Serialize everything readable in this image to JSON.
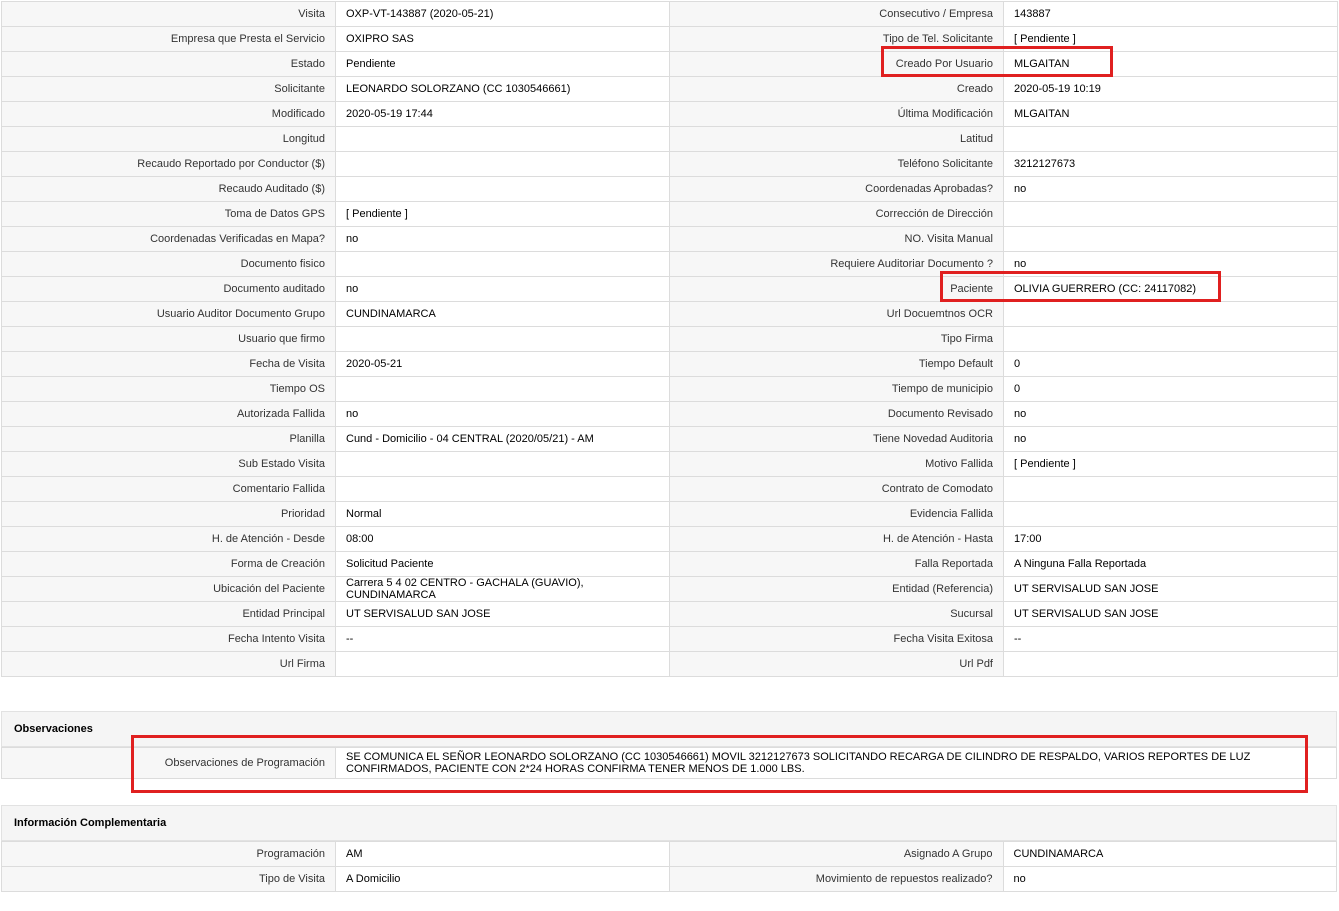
{
  "details": {
    "rows": [
      [
        {
          "label": "Visita",
          "value": "OXP-VT-143887 (2020-05-21)"
        },
        {
          "label": "Consecutivo / Empresa",
          "value": "143887"
        }
      ],
      [
        {
          "label": "Empresa que Presta el Servicio",
          "value": "OXIPRO SAS"
        },
        {
          "label": "Tipo de Tel. Solicitante",
          "value": "[ Pendiente ]"
        }
      ],
      [
        {
          "label": "Estado",
          "value": "Pendiente"
        },
        {
          "label": "Creado Por Usuario",
          "value": "MLGAITAN"
        }
      ],
      [
        {
          "label": "Solicitante",
          "value": "LEONARDO SOLORZANO (CC 1030546661)"
        },
        {
          "label": "Creado",
          "value": "2020-05-19 10:19"
        }
      ],
      [
        {
          "label": "Modificado",
          "value": "2020-05-19 17:44"
        },
        {
          "label": "Última Modificación",
          "value": " MLGAITAN"
        }
      ],
      [
        {
          "label": "Longitud",
          "value": ""
        },
        {
          "label": "Latitud",
          "value": ""
        }
      ],
      [
        {
          "label": "Recaudo Reportado por Conductor ($)",
          "value": ""
        },
        {
          "label": "Teléfono Solicitante",
          "value": "3212127673"
        }
      ],
      [
        {
          "label": "Recaudo Auditado ($)",
          "value": ""
        },
        {
          "label": "Coordenadas Aprobadas?",
          "value": " no"
        }
      ],
      [
        {
          "label": "Toma de Datos GPS",
          "value": "[ Pendiente ]"
        },
        {
          "label": "Corrección de Dirección",
          "value": ""
        }
      ],
      [
        {
          "label": "Coordenadas Verificadas en Mapa?",
          "value": " no"
        },
        {
          "label": "NO. Visita Manual",
          "value": ""
        }
      ],
      [
        {
          "label": "Documento fisico",
          "value": ""
        },
        {
          "label": "Requiere Auditoriar Documento ?",
          "value": " no"
        }
      ],
      [
        {
          "label": "Documento auditado",
          "value": " no"
        },
        {
          "label": "Paciente",
          "value": "OLIVIA GUERRERO (CC: 24117082)"
        }
      ],
      [
        {
          "label": "Usuario Auditor Documento Grupo",
          "value": "CUNDINAMARCA"
        },
        {
          "label": "Url Docuemtnos OCR",
          "value": ""
        }
      ],
      [
        {
          "label": "Usuario que firmo",
          "value": ""
        },
        {
          "label": "Tipo Firma",
          "value": ""
        }
      ],
      [
        {
          "label": "Fecha de Visita",
          "value": " 2020-05-21"
        },
        {
          "label": "Tiempo Default",
          "value": "0"
        }
      ],
      [
        {
          "label": "Tiempo OS",
          "value": ""
        },
        {
          "label": "Tiempo de municipio",
          "value": "0"
        }
      ],
      [
        {
          "label": "Autorizada Fallida",
          "value": " no"
        },
        {
          "label": "Documento Revisado",
          "value": " no"
        }
      ],
      [
        {
          "label": "Planilla",
          "value": "Cund - Domicilio - 04 CENTRAL (2020/05/21) - AM"
        },
        {
          "label": "Tiene Novedad Auditoria",
          "value": " no"
        }
      ],
      [
        {
          "label": "Sub Estado Visita",
          "value": ""
        },
        {
          "label": "Motivo Fallida",
          "value": "[ Pendiente ]"
        }
      ],
      [
        {
          "label": "Comentario Fallida",
          "value": ""
        },
        {
          "label": "Contrato de Comodato",
          "value": ""
        }
      ],
      [
        {
          "label": "Prioridad",
          "value": "Normal"
        },
        {
          "label": "Evidencia Fallida",
          "value": ""
        }
      ],
      [
        {
          "label": "H. de Atención - Desde",
          "value": "08:00"
        },
        {
          "label": "H. de Atención - Hasta",
          "value": "17:00"
        }
      ],
      [
        {
          "label": "Forma de Creación",
          "value": "Solicitud Paciente"
        },
        {
          "label": "Falla Reportada",
          "value": "A Ninguna Falla Reportada"
        }
      ],
      [
        {
          "label": "Ubicación del Paciente",
          "value": "Carrera 5 4 02 CENTRO - GACHALA (GUAVIO), CUNDINAMARCA"
        },
        {
          "label": "Entidad (Referencia)",
          "value": "UT SERVISALUD SAN JOSE"
        }
      ],
      [
        {
          "label": "Entidad Principal",
          "value": "UT SERVISALUD SAN JOSE"
        },
        {
          "label": "Sucursal",
          "value": "UT SERVISALUD SAN JOSE"
        }
      ],
      [
        {
          "label": "Fecha Intento Visita",
          "value": " --"
        },
        {
          "label": "Fecha Visita Exitosa",
          "value": " --"
        }
      ],
      [
        {
          "label": "Url Firma",
          "value": ""
        },
        {
          "label": "Url Pdf",
          "value": ""
        }
      ]
    ]
  },
  "observaciones": {
    "title": "Observaciones",
    "label": "Observaciones de Programación",
    "value": "  SE COMUNICA EL SEÑOR LEONARDO SOLORZANO (CC 1030546661) MOVIL 3212127673 SOLICITANDO RECARGA DE CILINDRO DE RESPALDO, VARIOS REPORTES DE LUZ CONFIRMADOS, PACIENTE CON 2*24 HORAS CONFIRMA TENER MENOS DE 1.000 LBS."
  },
  "complementaria": {
    "title": "Información Complementaria",
    "rows": [
      [
        {
          "label": "Programación",
          "value": "AM"
        },
        {
          "label": "Asignado A Grupo",
          "value": "CUNDINAMARCA"
        }
      ],
      [
        {
          "label": "Tipo de Visita",
          "value": "A Domicilio"
        },
        {
          "label": "Movimiento de repuestos realizado?",
          "value": " no"
        }
      ]
    ]
  },
  "colors": {
    "highlight": "#e02020",
    "label_bg": "#f7f7f7",
    "border": "#dcdcdc"
  }
}
